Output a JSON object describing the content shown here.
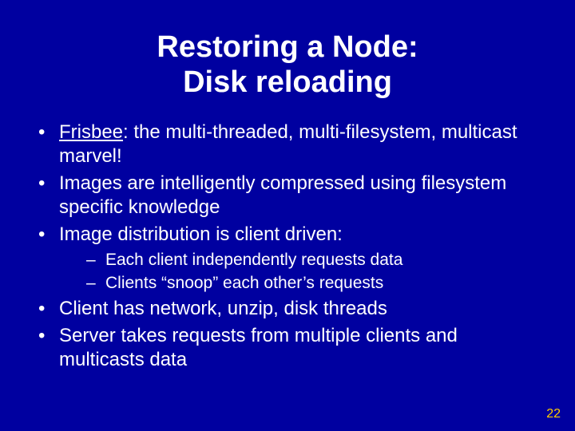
{
  "title": {
    "line1": "Restoring a Node:",
    "line2": "Disk reloading"
  },
  "bullets": {
    "b1_lead": "Frisbee",
    "b1_rest": ": the multi-threaded, multi-filesystem, multicast marvel!",
    "b2": "Images are intelligently compressed using filesystem specific knowledge",
    "b3": "Image distribution is client driven:",
    "sub1": "Each client independently requests data",
    "sub2": "Clients “snoop” each other’s requests",
    "b4": "Client has network, unzip, disk threads",
    "b5": "Server takes requests from multiple clients and multicasts data"
  },
  "page_number": "22"
}
